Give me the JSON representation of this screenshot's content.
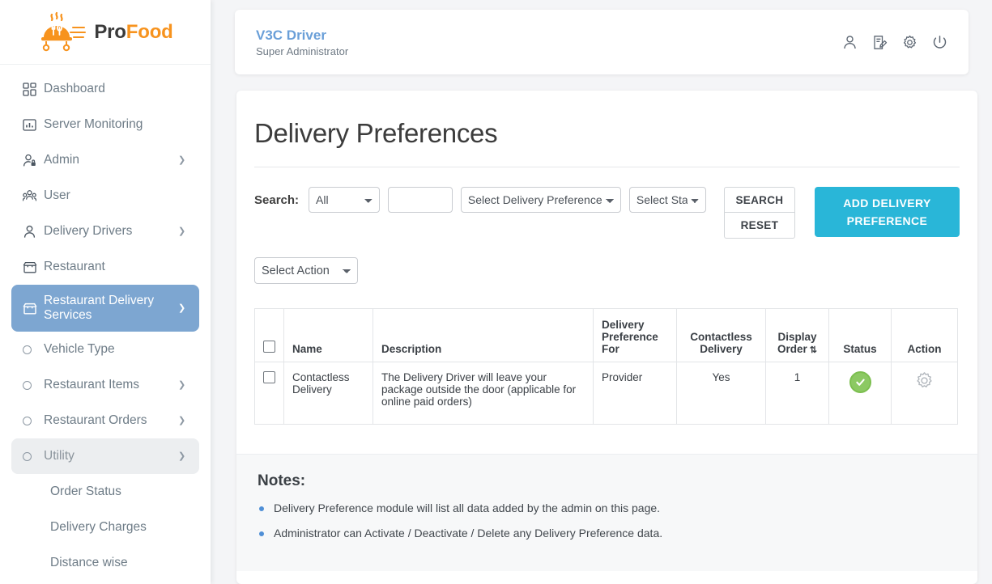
{
  "brand": {
    "name_part1": "Pro",
    "name_part2": "Food",
    "accent_orange": "#f7931e"
  },
  "sidebar": {
    "items": [
      {
        "label": "Dashboard",
        "icon": "grid-icon",
        "has_chevron": false,
        "state": "normal",
        "level": "top"
      },
      {
        "label": "Server Monitoring",
        "icon": "chart-bar-icon",
        "has_chevron": false,
        "state": "normal",
        "level": "top"
      },
      {
        "label": "Admin",
        "icon": "user-lock-icon",
        "has_chevron": true,
        "state": "normal",
        "level": "top"
      },
      {
        "label": "User",
        "icon": "users-group-icon",
        "has_chevron": false,
        "state": "normal",
        "level": "top"
      },
      {
        "label": "Delivery Drivers",
        "icon": "user-icon",
        "has_chevron": true,
        "state": "normal",
        "level": "top"
      },
      {
        "label": "Restaurant",
        "icon": "store-icon",
        "has_chevron": false,
        "state": "normal",
        "level": "top"
      },
      {
        "label": "Restaurant Delivery Services",
        "icon": "store-icon",
        "has_chevron": true,
        "state": "active",
        "level": "top"
      },
      {
        "label": "Vehicle Type",
        "icon": "circle-dot-icon",
        "has_chevron": false,
        "state": "normal",
        "level": "sub"
      },
      {
        "label": "Restaurant Items",
        "icon": "circle-dot-icon",
        "has_chevron": true,
        "state": "normal",
        "level": "sub"
      },
      {
        "label": "Restaurant Orders",
        "icon": "circle-dot-icon",
        "has_chevron": true,
        "state": "normal",
        "level": "sub"
      },
      {
        "label": "Utility",
        "icon": "circle-dot-icon",
        "has_chevron": true,
        "state": "softactive",
        "level": "sub"
      },
      {
        "label": "Order Status",
        "icon": "",
        "has_chevron": false,
        "state": "normal",
        "level": "child"
      },
      {
        "label": "Delivery Charges",
        "icon": "",
        "has_chevron": false,
        "state": "normal",
        "level": "child"
      },
      {
        "label": "Distance wise",
        "icon": "",
        "has_chevron": false,
        "state": "normal",
        "level": "child"
      }
    ],
    "active_color": "#7da6d1"
  },
  "topbar": {
    "user_name": "V3C Driver",
    "user_role": "Super Administrator",
    "name_color": "#6a9fd8",
    "icons": [
      {
        "name": "profile-icon"
      },
      {
        "name": "edit-document-icon"
      },
      {
        "name": "settings-gear-icon"
      },
      {
        "name": "power-logout-icon"
      }
    ]
  },
  "main": {
    "page_title": "Delivery Preferences",
    "filters": {
      "search_label": "Search:",
      "type_select": {
        "value": "All",
        "options": [
          "All"
        ]
      },
      "text_input": {
        "value": "",
        "placeholder": ""
      },
      "preference_select": {
        "value": "Select Delivery Preference",
        "options": [
          "Select Delivery Preference"
        ]
      },
      "status_select": {
        "value": "Select Status",
        "options": [
          "Select Status"
        ]
      },
      "search_button": "SEARCH",
      "reset_button": "RESET",
      "add_button": "ADD DELIVERY PREFERENCE",
      "add_button_color": "#29b6d8"
    },
    "bulk_action": {
      "value": "Select Action",
      "options": [
        "Select Action"
      ]
    },
    "table": {
      "columns": [
        {
          "key": "checkbox",
          "label": ""
        },
        {
          "key": "name",
          "label": "Name"
        },
        {
          "key": "desc",
          "label": "Description"
        },
        {
          "key": "preffor",
          "label": "Delivery Preference For"
        },
        {
          "key": "contactless",
          "label": "Contactless Delivery"
        },
        {
          "key": "order",
          "label": "Display Order",
          "sortable": true,
          "sort_icon": "sort-updown-icon"
        },
        {
          "key": "status",
          "label": "Status"
        },
        {
          "key": "action",
          "label": "Action"
        }
      ],
      "rows": [
        {
          "name": "Contactless Delivery",
          "desc": "The Delivery Driver will leave your package outside the door (applicable for online paid orders)",
          "preffor": "Provider",
          "contactless": "Yes",
          "order": "1",
          "status": "active",
          "status_icon": "check-circle-icon",
          "status_color": "#8cc963",
          "action_icon": "gear-icon"
        }
      ]
    },
    "notes": {
      "heading": "Notes:",
      "items": [
        "Delivery Preference module will list all data added by the admin on this page.",
        "Administrator can Activate / Deactivate / Delete any Delivery Preference data."
      ]
    }
  }
}
